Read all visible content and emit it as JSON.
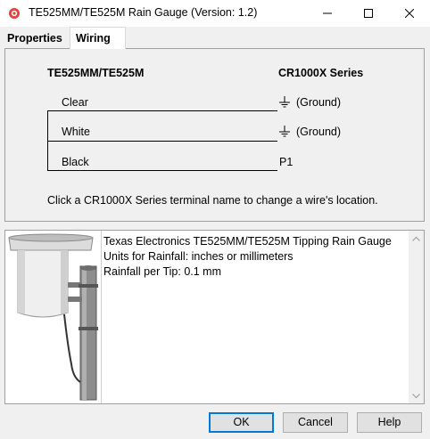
{
  "window": {
    "title": "TE525MM/TE525M Rain Gauge (Version: 1.2)"
  },
  "tabs": [
    {
      "label": "Properties"
    },
    {
      "label": "Wiring"
    }
  ],
  "wiring": {
    "sensor_header": "TE525MM/TE525M",
    "logger_header": "CR1000X Series",
    "wires": [
      {
        "name": "Clear",
        "terminal": "(Ground)",
        "icon": "ground-icon"
      },
      {
        "name": "White",
        "terminal": "(Ground)",
        "icon": "ground-icon"
      },
      {
        "name": "Black",
        "terminal": "P1"
      }
    ],
    "instruction": "Click a CR1000X Series terminal name to change a wire's location."
  },
  "info": {
    "lines": [
      "Texas Electronics TE525MM/TE525M Tipping Rain Gauge",
      "Units for Rainfall: inches or millimeters",
      "Rainfall per Tip: 0.1 mm"
    ]
  },
  "buttons": {
    "ok": "OK",
    "cancel": "Cancel",
    "help": "Help"
  },
  "colors": {
    "accent": "#0078d7",
    "app_icon": "#e0433b"
  }
}
